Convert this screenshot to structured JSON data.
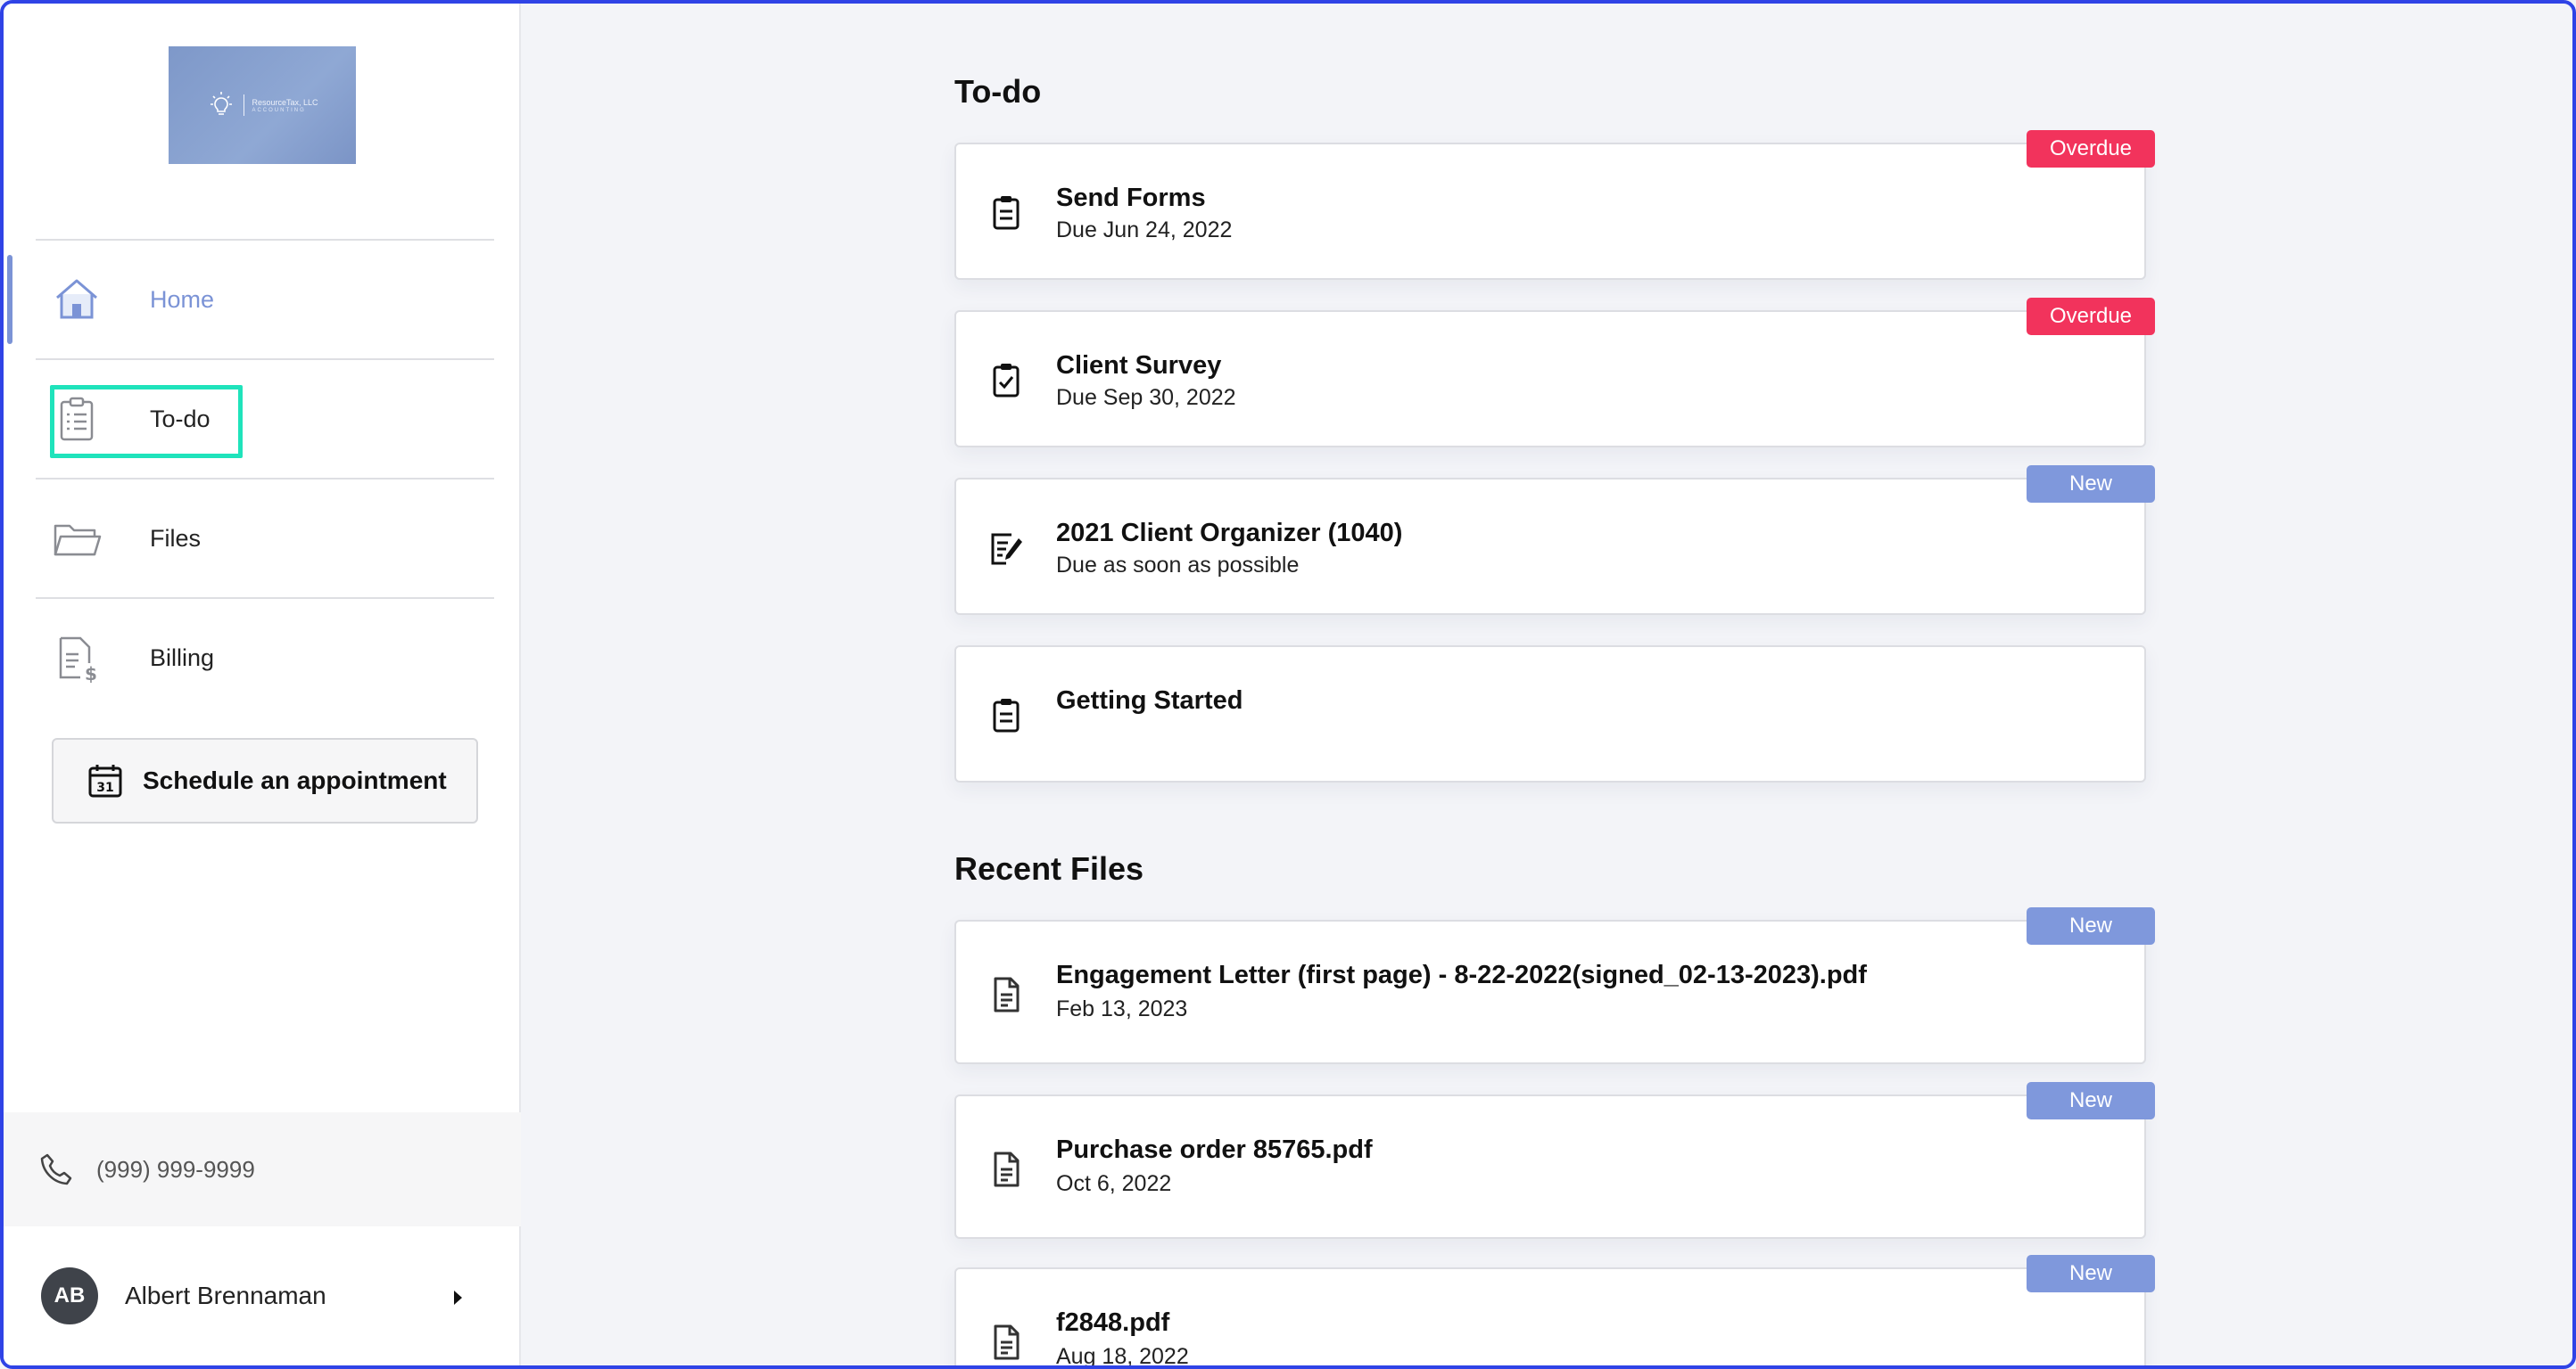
{
  "colors": {
    "accent": "#7b93d6",
    "overdue": "#f2335c",
    "new": "#7f98dc",
    "focus": "#1fe3bb",
    "frame": "#2f43e6"
  },
  "logo": {
    "line1": "ResourceTax, LLC",
    "line2": "ACCOUNTING"
  },
  "sidebar": {
    "items": [
      {
        "label": "Home",
        "icon": "home-icon"
      },
      {
        "label": "To-do",
        "icon": "clipboard-list-icon"
      },
      {
        "label": "Files",
        "icon": "folder-icon"
      },
      {
        "label": "Billing",
        "icon": "billing-document-icon"
      }
    ],
    "schedule_label": "Schedule an appointment",
    "schedule_icon_day": "31",
    "phone": "(999) 999-9999",
    "user": {
      "initials": "AB",
      "name": "Albert Brennaman"
    }
  },
  "todo": {
    "title": "To-do",
    "items": [
      {
        "title": "Send Forms",
        "sub": "Due Jun 24, 2022",
        "badge": "Overdue",
        "icon": "clipboard-icon"
      },
      {
        "title": "Client Survey",
        "sub": "Due Sep 30, 2022",
        "badge": "Overdue",
        "icon": "clipboard-check-icon"
      },
      {
        "title": "2021 Client Organizer (1040)",
        "sub": "Due as soon as possible",
        "badge": "New",
        "icon": "form-edit-icon"
      },
      {
        "title": "Getting Started",
        "sub": "",
        "badge": "",
        "icon": "clipboard-icon"
      }
    ]
  },
  "files": {
    "title": "Recent Files",
    "items": [
      {
        "title": "Engagement Letter (first page) - 8-22-2022(signed_02-13-2023).pdf",
        "sub": "Feb 13, 2023",
        "badge": "New",
        "icon": "file-icon"
      },
      {
        "title": "Purchase order 85765.pdf",
        "sub": "Oct 6, 2022",
        "badge": "New",
        "icon": "file-icon"
      },
      {
        "title": "f2848.pdf",
        "sub": "Aug 18, 2022",
        "badge": "New",
        "icon": "file-icon"
      }
    ]
  }
}
